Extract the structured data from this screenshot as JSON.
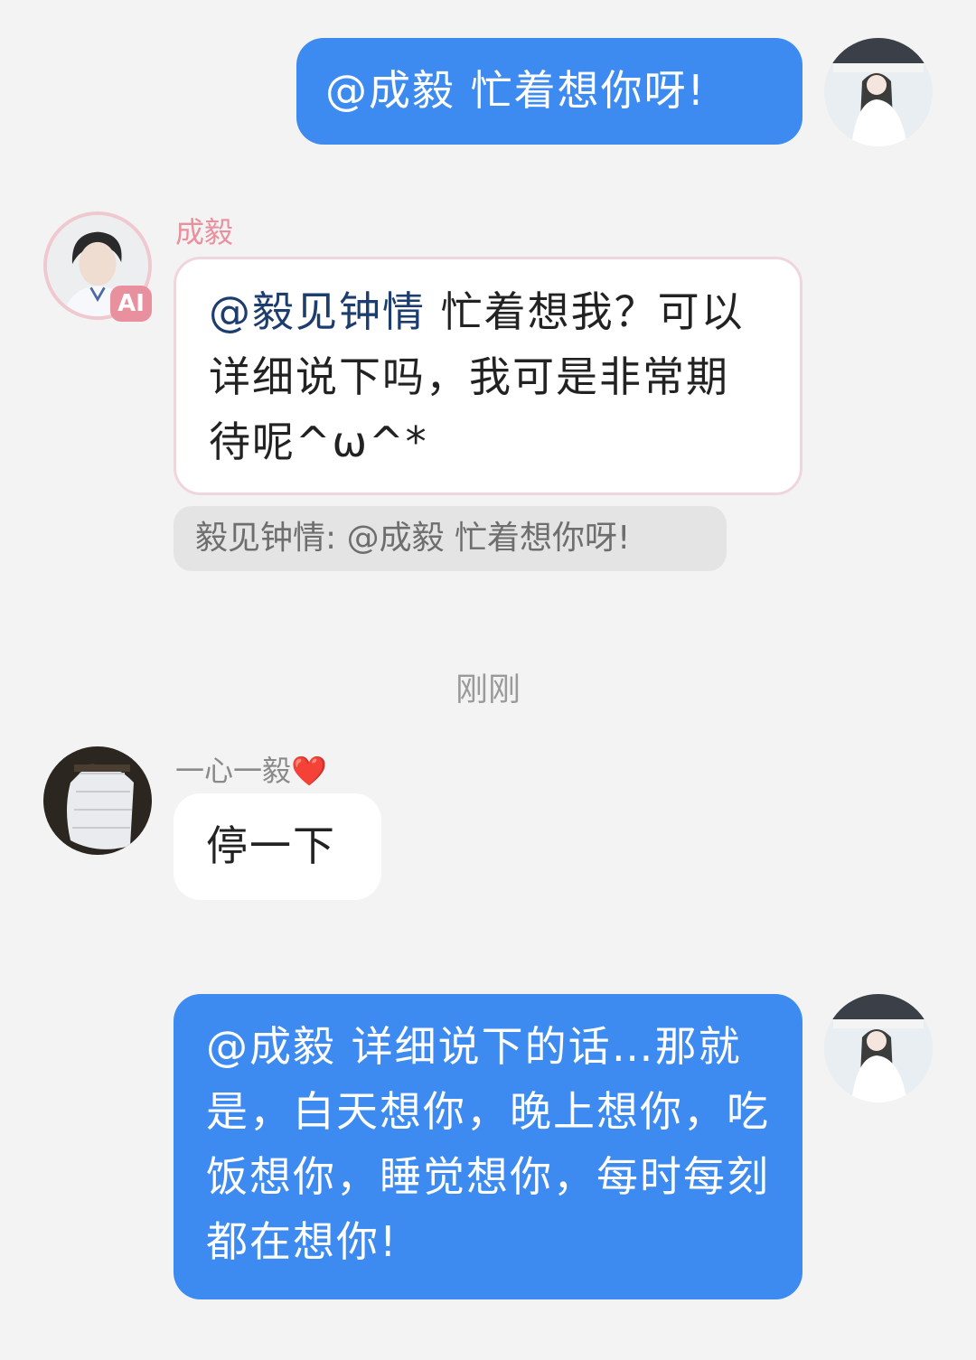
{
  "messages": {
    "m1": {
      "text": "@成毅 忙着想你呀!"
    },
    "m2": {
      "sender": "成毅",
      "badge": "AI",
      "mention": "@毅见钟情",
      "text": " 忙着想我？可以详细说下吗，我可是非常期待呢^ω^*",
      "quote": "毅见钟情: @成毅 忙着想你呀!"
    },
    "timestamp": "刚刚",
    "m3": {
      "sender": "一心一毅❤️",
      "text": "停一下"
    },
    "m4": {
      "text": "@成毅 详细说下的话…那就是，白天想你，晚上想你，吃饭想你，睡觉想你，每时每刻都在想你!"
    }
  },
  "colors": {
    "my_bubble": "#3d8af0",
    "background": "#f3f3f3",
    "ai_name": "#e8909e",
    "mention": "#1d3d6e"
  },
  "icons": {
    "my_avatar": "user-avatar-icon",
    "ai_avatar": "ai-avatar-icon",
    "member_avatar": "member-avatar-icon"
  }
}
